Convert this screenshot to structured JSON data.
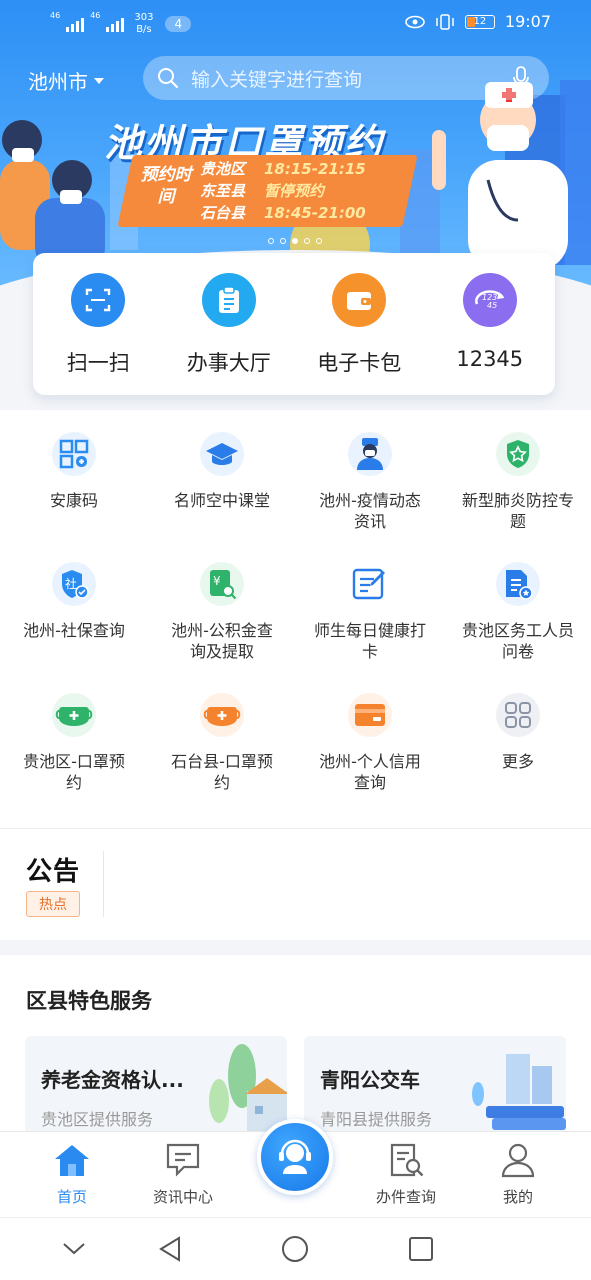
{
  "status_bar": {
    "signal1_label": "46",
    "signal2_label": "46",
    "speed_value": "303",
    "speed_unit": "B/s",
    "notification_count": "4",
    "battery_level": "12",
    "time": "19:07"
  },
  "header": {
    "city": "池州市",
    "search_placeholder": "输入关键字进行查询"
  },
  "banner": {
    "title": "池州市口罩预约",
    "card_label": "预约时间",
    "rows": [
      {
        "district": "贵池区",
        "time": "18:15-21:15"
      },
      {
        "district": "东至县",
        "time": "暂停预约"
      },
      {
        "district": "石台县",
        "time": "18:45-21:00"
      }
    ],
    "slide_count": 5,
    "active_slide": 3
  },
  "quick_actions": [
    {
      "label": "扫一扫",
      "icon": "scan-icon",
      "color": "#2a8cf0"
    },
    {
      "label": "办事大厅",
      "icon": "clipboard-icon",
      "color": "#22a9f0"
    },
    {
      "label": "电子卡包",
      "icon": "wallet-icon",
      "color": "#f5922c"
    },
    {
      "label": "12345",
      "icon": "hotline-icon",
      "color": "#8b6ef0"
    }
  ],
  "services": [
    {
      "label": "安康码",
      "icon": "qrcode-icon"
    },
    {
      "label": "名师空中课堂",
      "icon": "graduation-cap-icon"
    },
    {
      "label": "池州-疫情动态资讯",
      "icon": "doctor-icon"
    },
    {
      "label": "新型肺炎防控专题",
      "icon": "shield-star-icon"
    },
    {
      "label": "池州-社保查询",
      "icon": "social-security-icon"
    },
    {
      "label": "池州-公积金查询及提取",
      "icon": "fund-search-icon"
    },
    {
      "label": "师生每日健康打卡",
      "icon": "edit-form-icon"
    },
    {
      "label": "贵池区务工人员问卷",
      "icon": "survey-icon"
    },
    {
      "label": "贵池区-口罩预约",
      "icon": "mask-green-icon"
    },
    {
      "label": "石台县-口罩预约",
      "icon": "mask-orange-icon"
    },
    {
      "label": "池州-个人信用查询",
      "icon": "credit-card-icon"
    },
    {
      "label": "更多",
      "icon": "more-grid-icon"
    }
  ],
  "notice": {
    "title": "公告",
    "hot_label": "热点"
  },
  "district_services": {
    "title": "区县特色服务",
    "cards": [
      {
        "title": "养老金资格认...",
        "subtitle": "贵池区提供服务"
      },
      {
        "title": "青阳公交车",
        "subtitle": "青阳县提供服务"
      }
    ]
  },
  "tabbar": {
    "tabs": [
      {
        "label": "首页",
        "icon": "home-icon",
        "active": true
      },
      {
        "label": "资讯中心",
        "icon": "message-icon",
        "active": false
      },
      {
        "label": "办件查询",
        "icon": "document-search-icon",
        "active": false
      },
      {
        "label": "我的",
        "icon": "user-icon",
        "active": false
      }
    ],
    "center_icon": "customer-service-icon"
  },
  "colors": {
    "brand_blue": "#2b8af0",
    "banner_orange": "#f58a3c",
    "hot_orange": "#e7712d"
  }
}
